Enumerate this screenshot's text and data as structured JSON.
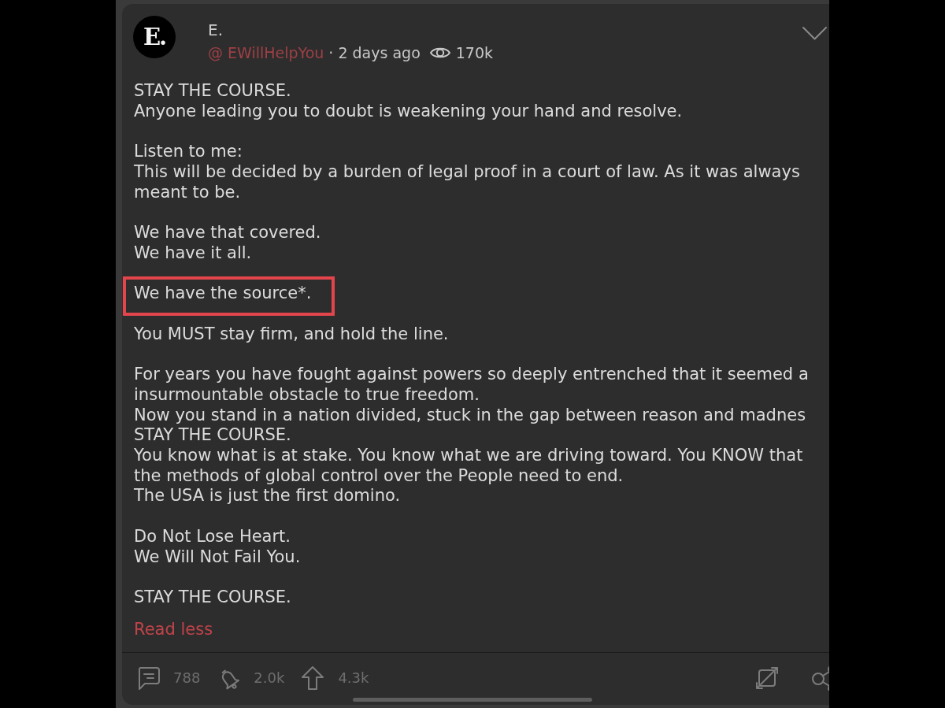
{
  "post": {
    "avatar_text": "E.",
    "author": "E.",
    "handle": "@ EWillHelpYou",
    "time": "· 2 days ago",
    "views": "170k"
  },
  "body": {
    "paragraphs": [
      {
        "lines": [
          "STAY THE COURSE.",
          "Anyone leading you to doubt is weakening your hand and resolve."
        ],
        "boxed": false
      },
      {
        "lines": [
          "Listen to me:",
          "This will be decided by a burden of legal proof in a court of law. As it was always",
          "meant to be."
        ],
        "boxed": false
      },
      {
        "lines": [
          "We have that covered.",
          "We have it all."
        ],
        "boxed": false
      },
      {
        "lines": [
          "We have the source*."
        ],
        "boxed": true
      },
      {
        "lines": [
          "You MUST stay firm, and hold the line."
        ],
        "boxed": false
      },
      {
        "lines": [
          "For years you have fought against powers so deeply entrenched that it seemed a",
          "insurmountable obstacle to true freedom.",
          "Now you stand in a nation divided, stuck in the gap between reason and madnes",
          "STAY THE COURSE.",
          "You know what is at stake. You know what we are driving toward. You KNOW that",
          "the methods of global control over the People need to end.",
          "The USA is just the first domino."
        ],
        "boxed": false
      },
      {
        "lines": [
          "Do Not Lose Heart.",
          "We Will Not Fail You."
        ],
        "boxed": false
      },
      {
        "lines": [
          "STAY THE COURSE."
        ],
        "boxed": false
      }
    ]
  },
  "read_less": "Read less",
  "actions": [
    {
      "kind": "comment",
      "count": "788"
    },
    {
      "kind": "bell",
      "count": "2.0k"
    },
    {
      "kind": "upvote",
      "count": "4.3k"
    }
  ]
}
